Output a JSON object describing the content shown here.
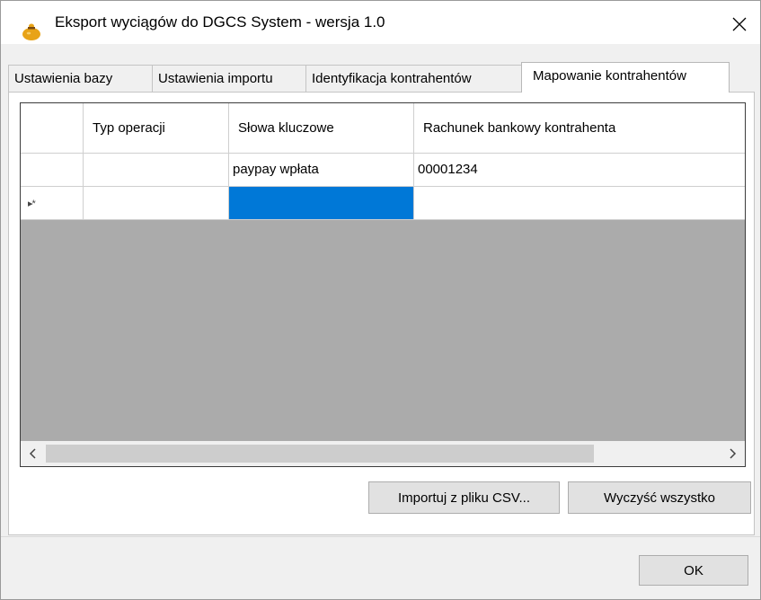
{
  "window": {
    "title": "Eksport wyciągów do DGCS System - wersja 1.0",
    "close_glyph": "✕"
  },
  "tabs": [
    {
      "label": "Ustawienia bazy"
    },
    {
      "label": "Ustawienia importu"
    },
    {
      "label": "Identyfikacja kontrahentów"
    },
    {
      "label": "Mapowanie kontrahentów",
      "active": true
    }
  ],
  "grid": {
    "columns": [
      "",
      "Typ operacji",
      "Słowa kluczowe",
      "Rachunek bankowy kontrahenta"
    ],
    "rows": [
      {
        "marker": "",
        "typ_operacji": "",
        "slowa_kluczowe": "paypay wpłata",
        "rachunek": "00001234"
      },
      {
        "marker": "▸*",
        "typ_operacji": "",
        "slowa_kluczowe": "",
        "rachunek": ""
      }
    ],
    "scroll_left_glyph": "<",
    "scroll_right_glyph": ">"
  },
  "buttons": {
    "import_csv": "Importuj z pliku CSV...",
    "clear_all": "Wyczyść wszystko",
    "ok": "OK"
  },
  "colors": {
    "selection": "#0078d7",
    "grid_background": "#ababab",
    "icon_gold": "#e8a317"
  },
  "icons": {
    "app": "money-bag-icon",
    "close": "close-icon"
  }
}
